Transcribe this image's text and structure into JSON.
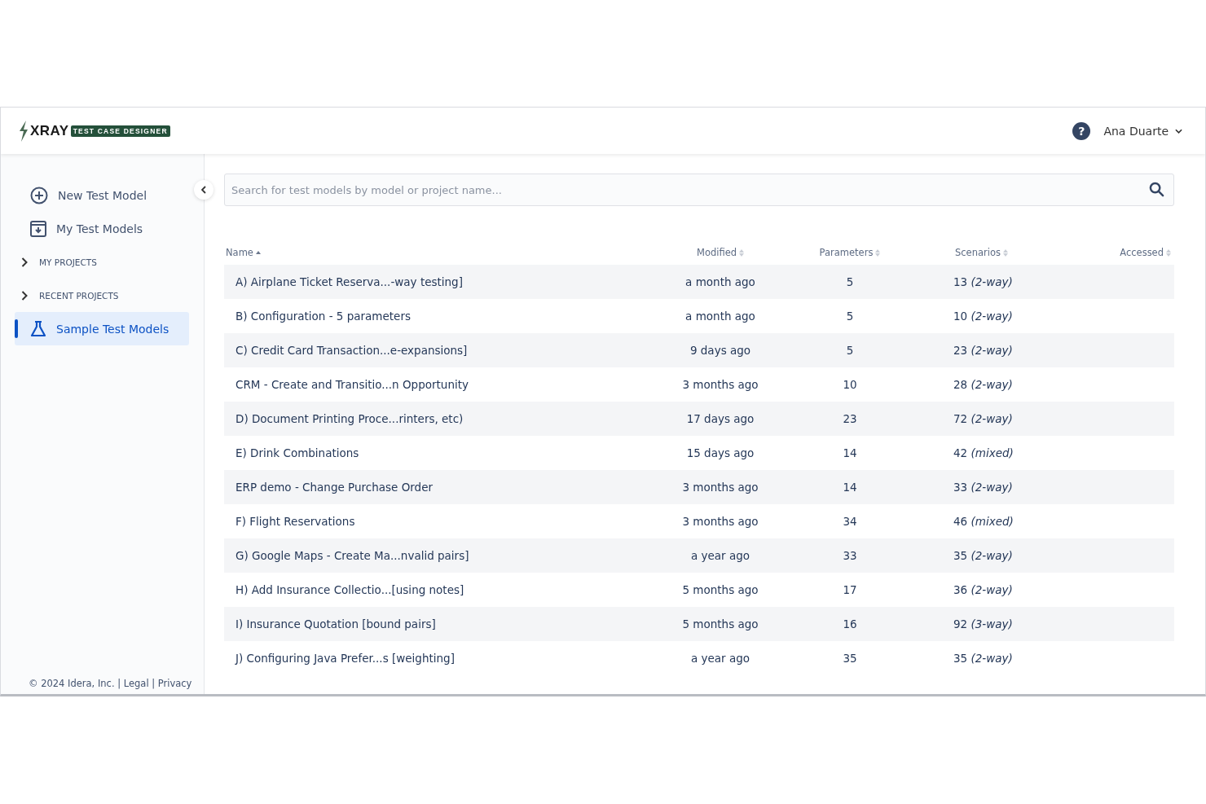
{
  "header": {
    "logo_word": "XRAY",
    "logo_badge": "TEST CASE DESIGNER",
    "help": "?",
    "user": "Ana Duarte"
  },
  "sidebar": {
    "items": [
      {
        "kind": "action",
        "label": "New Test Model",
        "selected": false
      },
      {
        "kind": "action",
        "label": "My Test Models",
        "selected": false
      },
      {
        "kind": "group",
        "label": "MY PROJECTS",
        "expanded": false
      },
      {
        "kind": "group",
        "label": "RECENT PROJECTS",
        "expanded": false
      },
      {
        "kind": "action",
        "label": "Sample Test Models",
        "selected": true
      }
    ],
    "footer": "© 2024 Idera, Inc. | Legal | Privacy"
  },
  "search": {
    "placeholder": "Search for test models by model or project name..."
  },
  "table": {
    "columns": [
      {
        "label": "Name",
        "sorted": true
      },
      {
        "label": "Modified",
        "sorted": false
      },
      {
        "label": "Parameters",
        "sorted": false
      },
      {
        "label": "Scenarios",
        "sorted": false
      },
      {
        "label": "Accessed",
        "sorted": false
      }
    ],
    "rows": [
      {
        "name": "A) Airplane Ticket Reserva...-way testing]",
        "modified": "a month ago",
        "parameters": "5",
        "scenarios": "13 *(2-way)*"
      },
      {
        "name": "B) Configuration - 5 parameters",
        "modified": "a month ago",
        "parameters": "5",
        "scenarios": "10 *(2-way)*"
      },
      {
        "name": "C) Credit Card Transaction...e-expansions]",
        "modified": "9 days ago",
        "parameters": "5",
        "scenarios": "23 *(2-way)*"
      },
      {
        "name": "CRM - Create and Transitio...n Opportunity",
        "modified": "3 months ago",
        "parameters": "10",
        "scenarios": "28 *(2-way)*"
      },
      {
        "name": "D) Document Printing Proce...rinters, etc)",
        "modified": "17 days ago",
        "parameters": "23",
        "scenarios": "72 *(2-way)*"
      },
      {
        "name": "E) Drink Combinations",
        "modified": "15 days ago",
        "parameters": "14",
        "scenarios": "42 *(mixed)*"
      },
      {
        "name": "ERP demo - Change Purchase Order",
        "modified": "3 months ago",
        "parameters": "14",
        "scenarios": "33 *(2-way)*"
      },
      {
        "name": "F) Flight Reservations",
        "modified": "3 months ago",
        "parameters": "34",
        "scenarios": "46 *(mixed)*"
      },
      {
        "name": "G) Google Maps - Create Ma...nvalid pairs]",
        "modified": "a year ago",
        "parameters": "33",
        "scenarios": "35 *(2-way)*"
      },
      {
        "name": "H) Add Insurance Collectio...[using notes]",
        "modified": "5 months ago",
        "parameters": "17",
        "scenarios": "36 *(2-way)*"
      },
      {
        "name": "I) Insurance Quotation [bound pairs]",
        "modified": "5 months ago",
        "parameters": "16",
        "scenarios": "92 *(3-way)*"
      },
      {
        "name": "J) Configuring Java Prefer...s [weighting]",
        "modified": "a year ago",
        "parameters": "35",
        "scenarios": "35 *(2-way)*"
      }
    ]
  }
}
